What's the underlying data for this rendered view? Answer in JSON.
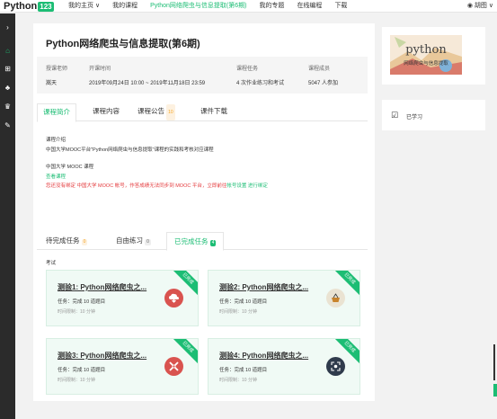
{
  "topnav": {
    "logo_text": "Python",
    "logo_num": "123",
    "items": [
      "我的主页 ∨",
      "我的课程",
      "Python网络爬虫与信息提取(第6期)",
      "我的专题",
      "在线编程",
      "下载"
    ],
    "user": "胡图 ∨"
  },
  "course": {
    "title": "Python网络爬虫与信息提取(第6期)",
    "teacher_label": "授课老师",
    "teacher": "嵩天",
    "time_label": "开课时间",
    "time": "2019年09月24日 10:00 ~ 2019年11月18日 23:59",
    "tasks_label": "课程任务",
    "tasks": "4 次作业练习和考试",
    "members_label": "课程成员",
    "members": "5047 人参加"
  },
  "tabs": {
    "intro": "课程简介",
    "content": "课程内容",
    "notice": "课程公告",
    "notice_count": "10",
    "download": "课件下载"
  },
  "intro": {
    "label": "课程介绍",
    "text": "中国大学MOOC平台\"Python网络爬虫与信息提取\"课程的实践和考核对应课程",
    "mooc_label": "中国大学 MOOC 课程",
    "view_link": "查看课程",
    "warn_text": "您还没有绑定 中国大学 MOOC 帐号，作答成绩无法同步到 MOOC 平台，立即前往",
    "bind_link": "帐号设置 进行绑定"
  },
  "task_tabs": {
    "pending": "待完成任务",
    "pending_count": "0",
    "free": "自由练习",
    "free_count": "0",
    "done": "已完成任务",
    "done_count": "4"
  },
  "exam_label": "考试",
  "quizzes": [
    {
      "title": "测验1: Python网络爬虫之...",
      "task": "任务：完成 10 道题目",
      "time": "时间限制：10 分钟",
      "corner": "已完成"
    },
    {
      "title": "测验2: Python网络爬虫之...",
      "task": "任务：完成 10 道题目",
      "time": "时间限制：10 分钟",
      "corner": "已完成"
    },
    {
      "title": "测验3: Python网络爬虫之...",
      "task": "任务：完成 10 道题目",
      "time": "时间限制：10 分钟",
      "corner": "已完成"
    },
    {
      "title": "测验4: Python网络爬虫之...",
      "task": "任务：完成 10 道题目",
      "time": "时间限制：10 分钟",
      "corner": "已完成"
    }
  ],
  "side": {
    "thumb_title": "python",
    "thumb_sub": "网络爬虫与信息提取",
    "learned": "已学习"
  },
  "colors": {
    "accent": "#1cbd74",
    "sidebar": "#2b2b2b",
    "warn": "#e4393c",
    "orange": "#f5a623"
  }
}
